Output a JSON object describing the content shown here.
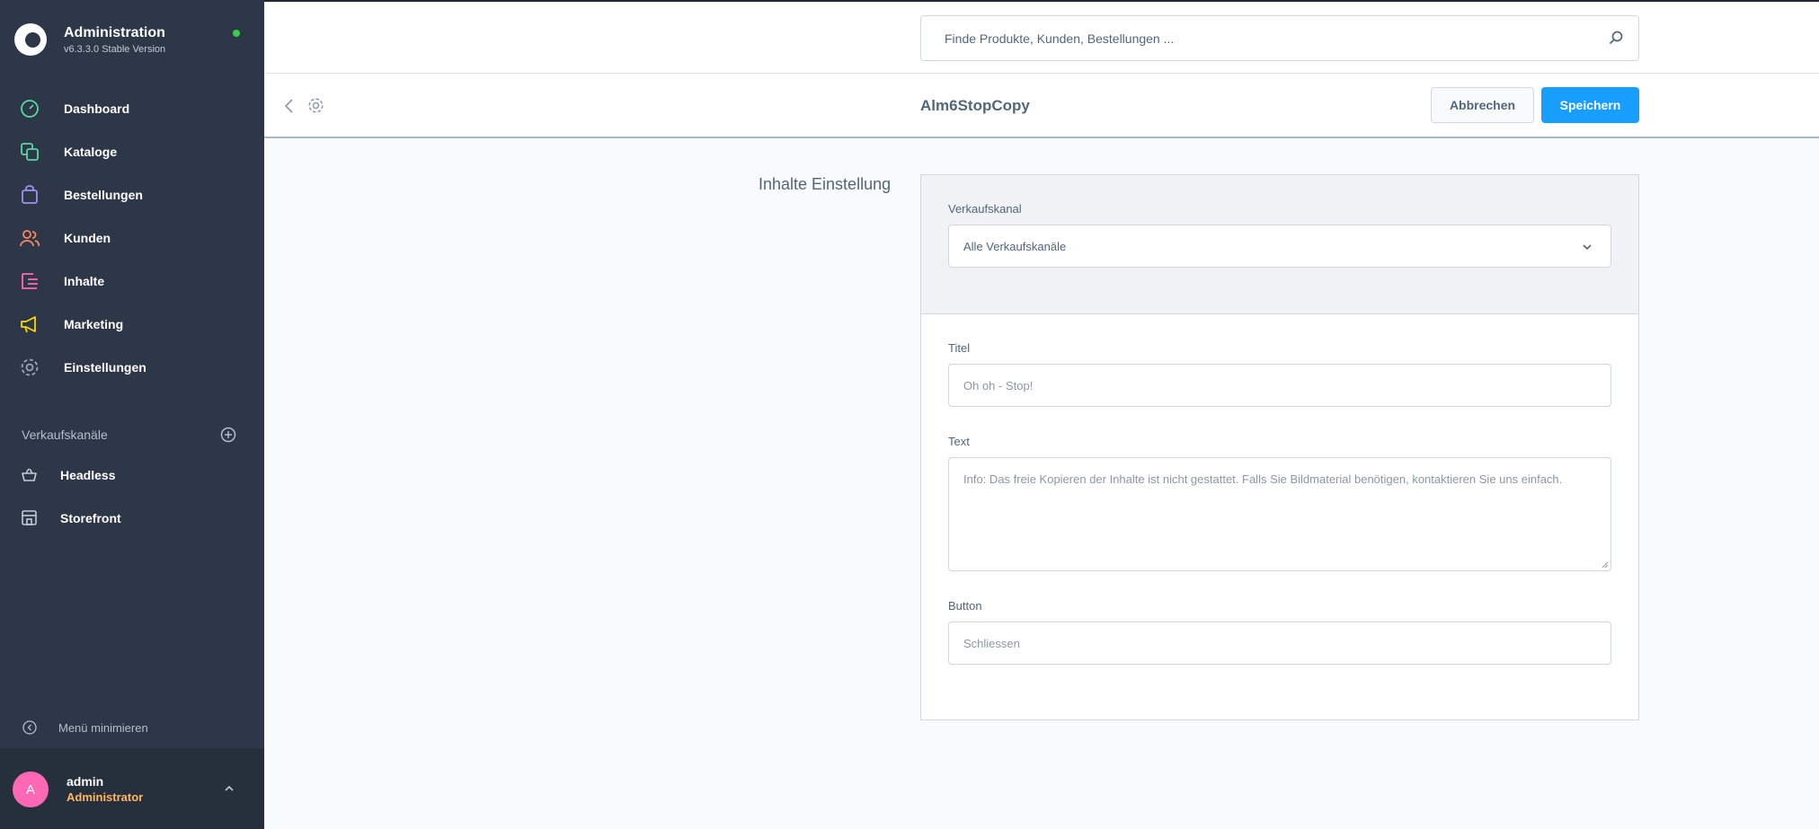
{
  "app": {
    "title": "Administration",
    "version": "v6.3.3.0 Stable Version"
  },
  "sidebar": {
    "nav": [
      {
        "label": "Dashboard",
        "icon": "dashboard-icon",
        "color": "#57d9a3"
      },
      {
        "label": "Kataloge",
        "icon": "catalog-icon",
        "color": "#57d9a3"
      },
      {
        "label": "Bestellungen",
        "icon": "orders-icon",
        "color": "#a092f0"
      },
      {
        "label": "Kunden",
        "icon": "customers-icon",
        "color": "#f88962"
      },
      {
        "label": "Inhalte",
        "icon": "content-icon",
        "color": "#ff68b4"
      },
      {
        "label": "Marketing",
        "icon": "marketing-icon",
        "color": "#ffd700"
      },
      {
        "label": "Einstellungen",
        "icon": "settings-icon",
        "color": "#9aa8b5"
      }
    ],
    "sales_channels_title": "Verkaufskanäle",
    "channels": [
      {
        "label": "Headless",
        "icon": "basket-icon"
      },
      {
        "label": "Storefront",
        "icon": "storefront-icon"
      }
    ],
    "minimize_label": "Menü minimieren",
    "user": {
      "initial": "A",
      "name": "admin",
      "role": "Administrator"
    }
  },
  "search": {
    "placeholder": "Finde Produkte, Kunden, Bestellungen ..."
  },
  "smartbar": {
    "title": "Alm6StopCopy",
    "cancel_label": "Abbrechen",
    "save_label": "Speichern"
  },
  "content": {
    "card_label": "Inhalte Einstellung",
    "sales_channel_label": "Verkaufskanal",
    "sales_channel_value": "Alle Verkaufskanäle",
    "title_label": "Titel",
    "title_placeholder": "Oh oh - Stop!",
    "text_label": "Text",
    "text_placeholder": "Info: Das freie Kopieren der Inhalte ist nicht gestattet. Falls Sie Bildmaterial benötigen, kontaktieren Sie uns einfach.",
    "button_label": "Button",
    "button_placeholder": "Schliessen"
  },
  "colors": {
    "sidebar_bg": "#2d3748",
    "primary": "#189eff",
    "status_online": "#37d046",
    "avatar": "#ff68b4",
    "role": "#ffb75d"
  }
}
